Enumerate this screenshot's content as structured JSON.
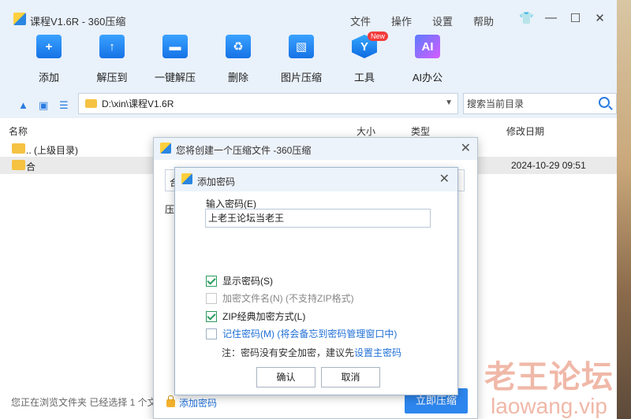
{
  "window": {
    "title": "课程V1.6R - 360压缩",
    "menu": [
      "文件",
      "操作",
      "设置",
      "帮助"
    ],
    "controls": [
      "👕",
      "—",
      "☐",
      "✕"
    ]
  },
  "toolbar": {
    "items": [
      {
        "label": "添加",
        "icon": "add-file-icon",
        "glyph": "+"
      },
      {
        "label": "解压到",
        "icon": "extract-to-icon",
        "glyph": "↑"
      },
      {
        "label": "一键解压",
        "icon": "one-click-extract-icon",
        "glyph": "▬"
      },
      {
        "label": "删除",
        "icon": "recycle-bin-icon",
        "glyph": "♻"
      },
      {
        "label": "图片压缩",
        "icon": "image-compress-icon",
        "glyph": "▧"
      },
      {
        "label": "工具",
        "icon": "tools-icon",
        "glyph": "Y"
      },
      {
        "label": "AI办公",
        "icon": "ai-office-icon",
        "glyph": "AI"
      }
    ],
    "new_badge": "New"
  },
  "address": {
    "path": "D:\\xin\\课程V1.6R",
    "search_placeholder": "搜索当前目录"
  },
  "list": {
    "headers": {
      "name": "名称",
      "size": "大小",
      "type": "类型",
      "modified": "修改日期"
    },
    "rows": [
      {
        "name": ".. (上级目录)",
        "date": ""
      },
      {
        "name": "合",
        "date": "2024-10-29 09:51"
      }
    ]
  },
  "status": "您正在浏览文件夹 已经选择 1 个文",
  "create_dialog": {
    "title": "您将创建一个压缩文件 -360压缩",
    "field_fragment": "合",
    "label_fragment": "压",
    "add_password_link": "添加密码",
    "compress_button": "立即压缩"
  },
  "password_dialog": {
    "title": "添加密码",
    "input_label": "输入密码(E)",
    "input_value": "上老王论坛当老王",
    "options": [
      {
        "label": "显示密码(S)",
        "checked": true,
        "enabled": true
      },
      {
        "label": "加密文件名(N) (不支持ZIP格式)",
        "checked": false,
        "enabled": false
      },
      {
        "label": "ZIP经典加密方式(L)",
        "checked": true,
        "enabled": true
      },
      {
        "label": "记住密码(M) (将会备忘到密码管理窗口中)",
        "checked": false,
        "enabled": true
      }
    ],
    "note_prefix": "注：密码没有安全加密，建议先",
    "note_link": "设置主密码",
    "ok": "确认",
    "cancel": "取消"
  },
  "watermark": {
    "line1": "老王论坛",
    "line2": "laowang.vip"
  }
}
